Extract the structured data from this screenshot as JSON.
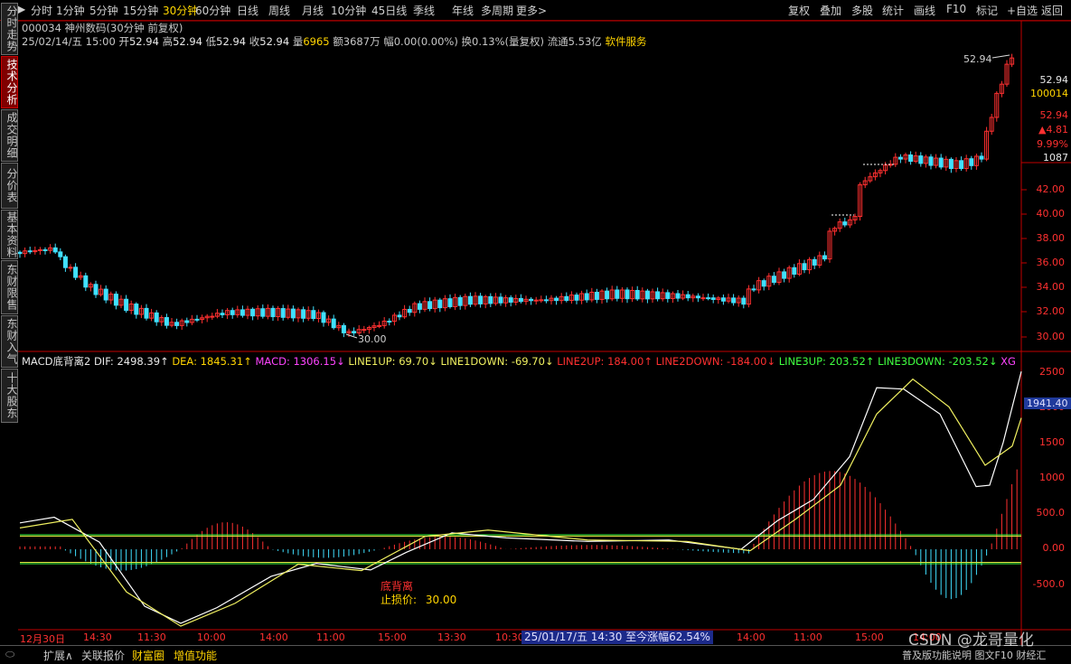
{
  "toolbar": {
    "periods": [
      "分时",
      "1分钟",
      "5分钟",
      "15分钟",
      "30分钟",
      "60分钟",
      "日线",
      "周线",
      "月线",
      "10分钟",
      "45日线",
      "季线",
      "年线",
      "多周期",
      "更多>"
    ],
    "active_period": "30分钟",
    "right_buttons": [
      "复权",
      "叠加",
      "多股",
      "统计",
      "画线",
      "F10",
      "标记",
      "+自选",
      "返回"
    ]
  },
  "side_tabs": [
    "分时走势",
    "技术分析",
    "成交明细",
    "分价表",
    "基本资料",
    "东财限售",
    "东财入气",
    "十大股东"
  ],
  "active_side_tab": "技术分析",
  "quote": {
    "code_name": "000034 神州数码(30分钟 前复权)",
    "date": "25/02/14/五 15:00",
    "open_label": "开",
    "open": "52.94",
    "high_label": "高",
    "high": "52.94",
    "low_label": "低",
    "low": "52.94",
    "close_label": "收",
    "close": "52.94",
    "vol_label": "量",
    "vol": "6965",
    "amount": "额3687万",
    "amp": "幅0.00(0.00%)",
    "turnover": "换0.13%(量复权)",
    "float_cap": "流通5.53亿",
    "industry": "软件服务"
  },
  "price_axis": {
    "ticks": [
      "42.00",
      "40.00",
      "38.00",
      "36.00",
      "34.00",
      "32.00",
      "30.00"
    ],
    "side_values": [
      "52.94",
      "100014",
      "52.94",
      "▲4.81",
      "9.99%",
      "1087"
    ]
  },
  "annotations": {
    "high_price": "52.94",
    "low_price": "30.00"
  },
  "indicator": {
    "name": "MACD底背离2",
    "dif": "DIF: 2498.39↑",
    "dea": "DEA: 1845.31↑",
    "macd": "MACD: 1306.15↓",
    "line1up": "LINE1UP: 69.70↓",
    "line1down": "LINE1DOWN: -69.70↓",
    "line2up": "LINE2UP: 184.00↑",
    "line2down": "LINE2DOWN: -184.00↓",
    "line3up": "LINE3UP: 203.52↑",
    "line3down": "LINE3DOWN: -203.52↓",
    "xg": "XG",
    "ticks": [
      "2500",
      "2000",
      "1500",
      "1000",
      "500.0",
      "0.00",
      "-500.0"
    ],
    "current": "1941.40",
    "signal_label": "底背离",
    "stop_label": "止损价:",
    "stop_value": "30.00"
  },
  "time_axis": {
    "labels": [
      "12月30日",
      "14:30",
      "11:30",
      "10:00",
      "14:00",
      "11:00",
      "15:00",
      "13:30",
      "10:30",
      "14:00",
      "11:00",
      "15:00",
      "14:00"
    ],
    "cursor_text": "25/01/17/五  14:30  至今涨幅62.54%"
  },
  "bottom": {
    "expand": "扩展∧",
    "related": "关联报价",
    "caifutong": "财富圈",
    "addon": "增值功能",
    "notice": "普及版功能说明 图文F10 财经汇",
    "watermark": "CSDN @龙哥量化"
  },
  "colors": {
    "up": "#ff3030",
    "down": "#40e0ff",
    "bg": "#000000",
    "grid": "#8b0000"
  }
}
